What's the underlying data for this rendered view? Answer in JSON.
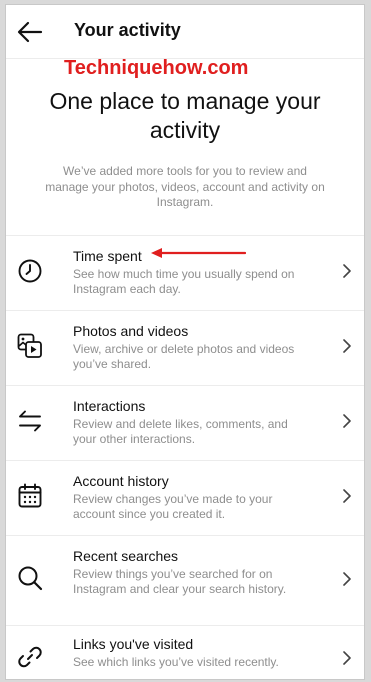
{
  "header": {
    "title": "Your activity",
    "back_icon": "arrow-left-icon"
  },
  "watermark": "Techniquehow.com",
  "headline": {
    "line1": "One place to manage your",
    "line2": "activity"
  },
  "description": "We’ve added more tools for you to review and manage your photos, videos, account and activity on Instagram.",
  "colors": {
    "annotation_arrow": "#e01f1f",
    "watermark": "#e01f1f",
    "muted_text": "#8e8e8e"
  },
  "items": [
    {
      "title": "Time spent",
      "subtitle": "See how much time you usually spend on Instagram each day.",
      "icon": "clock-icon"
    },
    {
      "title": "Photos and videos",
      "subtitle": "View, archive or delete photos and videos you’ve shared.",
      "icon": "photos-videos-icon"
    },
    {
      "title": "Interactions",
      "subtitle": "Review and delete likes, comments, and your other interactions.",
      "icon": "interactions-arrows-icon"
    },
    {
      "title": "Account history",
      "subtitle": "Review changes you’ve made to your account since you created it.",
      "icon": "calendar-icon"
    },
    {
      "title": "Recent searches",
      "subtitle": "Review things you’ve searched for on Instagram and clear your search history.",
      "icon": "search-icon"
    },
    {
      "title": "Links you've visited",
      "subtitle": "See which links you’ve visited recently.",
      "icon": "link-icon"
    }
  ]
}
